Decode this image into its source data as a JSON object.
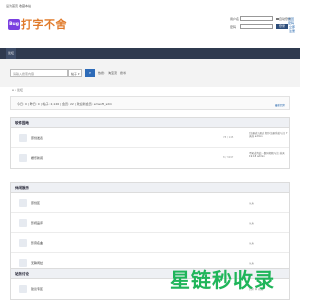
{
  "topbar": {
    "links": "设为首页 收藏本站"
  },
  "brand": {
    "logo_text": "Bug",
    "name": "打字不舍"
  },
  "login": {
    "user_label": "用户名",
    "pass_label": "密码",
    "remember_label": "自动登录",
    "forgot_link": "找回密码",
    "register_link": "立即注册",
    "login_button": "登录"
  },
  "nav": {
    "items": [
      "论坛"
    ]
  },
  "search": {
    "placeholder": "请输入搜索内容",
    "type_label": "帖子",
    "button_label": "搜",
    "links": [
      "热搜:",
      "淘宝流",
      "搜寻"
    ]
  },
  "breadcrumb": "⌂ › 论坛",
  "notice": {
    "text": "今日: 0 | 昨日: 0 | 帖子: 2,126 | 会员: 22 | 欢迎新会员: emsoft_sdm",
    "right": "最新回复"
  },
  "sections": [
    {
      "title": "软件园地",
      "forums": [
        {
          "name": "原创发表",
          "count": "78 / 145",
          "last": "[注册表] 通过 程序注册系统与注 \n 7 天前 admin"
        },
        {
          "name": "娱乐新闻",
          "count": "8 / 3297",
          "last": "不知道为此...数码相机与注 \n 前天 19:18 admin"
        }
      ]
    },
    {
      "title": "休闲娱乐",
      "forums": [
        {
          "name": "原创区",
          "count": "",
          "last": "从未"
        },
        {
          "name": "影视品评",
          "count": "",
          "last": "从未"
        },
        {
          "name": "影音名曲",
          "count": "",
          "last": "从未"
        },
        {
          "name": "无聊闲扯",
          "count": "",
          "last": "从未"
        }
      ]
    },
    {
      "title": "站务讨论",
      "forums": [
        {
          "name": "建议专区",
          "count": "",
          "last": "回复 中 欢迎"
        }
      ]
    }
  ],
  "watermark": "星链秒收录"
}
